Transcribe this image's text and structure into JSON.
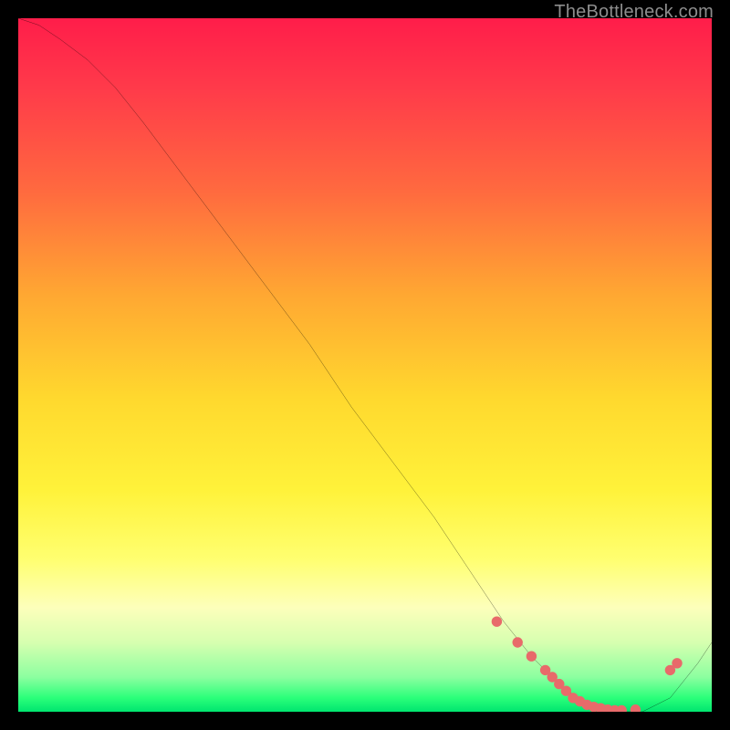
{
  "watermark": "TheBottleneck.com",
  "chart_data": {
    "type": "line",
    "title": "",
    "xlabel": "",
    "ylabel": "",
    "xlim": [
      0,
      100
    ],
    "ylim": [
      0,
      100
    ],
    "series": [
      {
        "name": "curve",
        "x": [
          0,
          3,
          6,
          10,
          14,
          18,
          24,
          30,
          36,
          42,
          48,
          54,
          60,
          66,
          70,
          74,
          78,
          82,
          86,
          90,
          94,
          98,
          100
        ],
        "y": [
          100,
          99,
          97,
          94,
          90,
          85,
          77,
          69,
          61,
          53,
          44,
          36,
          28,
          19,
          13,
          8,
          4,
          1,
          0,
          0,
          2,
          7,
          10
        ]
      }
    ],
    "markers": {
      "name": "highlight-dots",
      "color": "#e86a6a",
      "x": [
        69,
        72,
        74,
        76,
        77,
        78,
        79,
        80,
        81,
        82,
        83,
        84,
        85,
        86,
        87,
        89,
        94,
        95
      ],
      "y": [
        13,
        10,
        8,
        6,
        5,
        4,
        3,
        2,
        1.5,
        1,
        0.7,
        0.5,
        0.3,
        0.2,
        0.2,
        0.3,
        6,
        7
      ]
    }
  }
}
